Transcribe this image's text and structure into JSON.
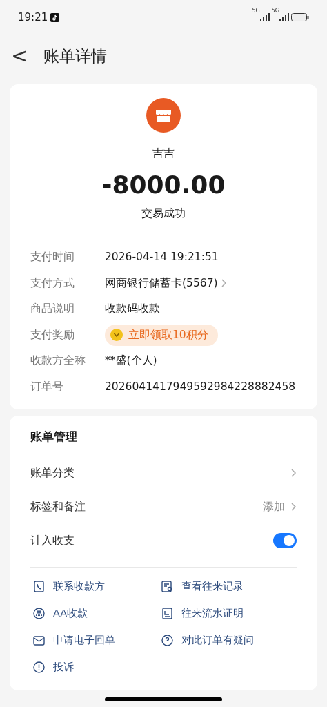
{
  "status_bar": {
    "time": "19:21",
    "signals": [
      {
        "label": "5G"
      },
      {
        "label": "5G"
      }
    ]
  },
  "header": {
    "back": "<",
    "title": "账单详情"
  },
  "summary": {
    "merchant": "吉吉",
    "amount": "-8000.00",
    "status": "交易成功"
  },
  "details": [
    {
      "kind": "text",
      "label": "支付时间",
      "value": "2026-04-14 19:21:51"
    },
    {
      "kind": "link",
      "label": "支付方式",
      "value": "网商银行储蓄卡(5567)"
    },
    {
      "kind": "text",
      "label": "商品说明",
      "value": "收款码收款"
    },
    {
      "kind": "reward",
      "label": "支付奖励",
      "value": "立即领取10积分"
    },
    {
      "kind": "text",
      "label": "收款方全称",
      "value": "**盛(个人)"
    },
    {
      "kind": "text",
      "label": "订单号",
      "value": "2026041417949592984228882458"
    }
  ],
  "management": {
    "title": "账单管理",
    "rows": [
      {
        "kind": "link",
        "label": "账单分类"
      },
      {
        "kind": "link",
        "label": "标签和备注",
        "value": "添加"
      },
      {
        "kind": "toggle",
        "label": "计入收支",
        "on": true
      }
    ]
  },
  "actions": [
    {
      "label": "联系收款方"
    },
    {
      "label": "查看往来记录"
    },
    {
      "label": "AA收款"
    },
    {
      "label": "往来流水证明"
    },
    {
      "label": "申请电子回单"
    },
    {
      "label": "对此订单有疑问"
    },
    {
      "label": "投诉"
    }
  ]
}
